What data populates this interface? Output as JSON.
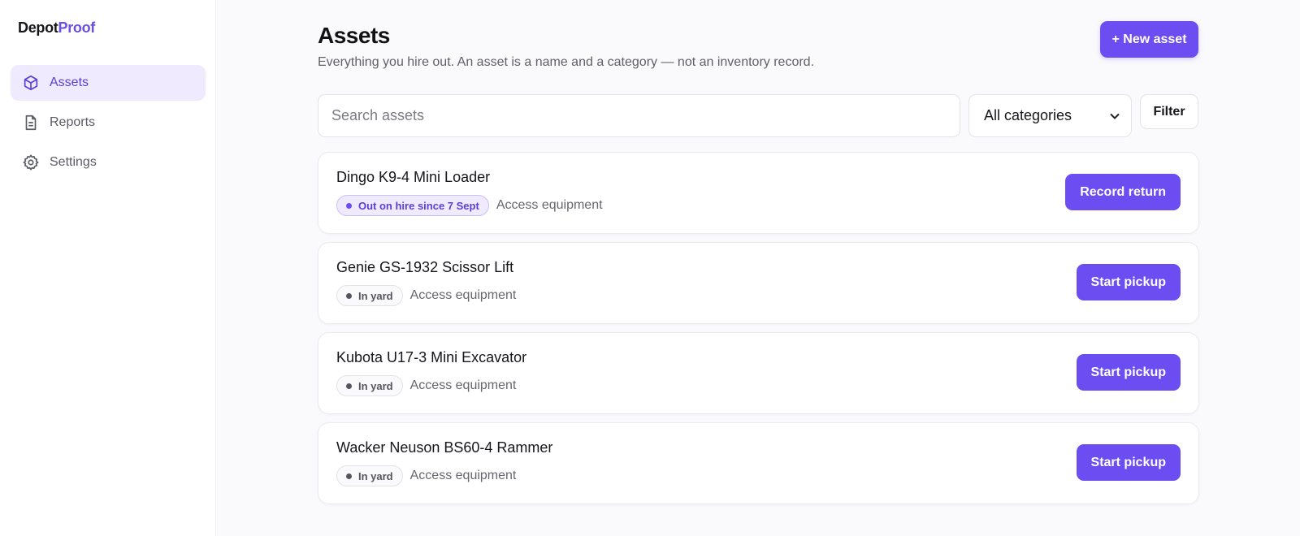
{
  "brand": {
    "part1": "Depot",
    "part2": "Proof"
  },
  "sidebar": {
    "items": [
      {
        "label": "Assets",
        "icon": "box-icon",
        "active": true
      },
      {
        "label": "Reports",
        "icon": "document-icon",
        "active": false
      },
      {
        "label": "Settings",
        "icon": "gear-icon",
        "active": false
      }
    ]
  },
  "header": {
    "title": "Assets",
    "subtitle": "Everything you hire out. An asset is a name and a category — not an inventory record.",
    "new_button": "+ New asset"
  },
  "toolbar": {
    "search_placeholder": "Search assets",
    "category_selected": "All categories",
    "filter_label": "Filter"
  },
  "assets": [
    {
      "name": "Dingo K9-4 Mini Loader",
      "status": "Out on hire since 7 Sept",
      "status_kind": "hire",
      "category": "Access equipment",
      "action": "Record return"
    },
    {
      "name": "Genie GS-1932 Scissor Lift",
      "status": "In yard",
      "status_kind": "yard",
      "category": "Access equipment",
      "action": "Start pickup"
    },
    {
      "name": "Kubota U17-3 Mini Excavator",
      "status": "In yard",
      "status_kind": "yard",
      "category": "Access equipment",
      "action": "Start pickup"
    },
    {
      "name": "Wacker Neuson BS60-4 Rammer",
      "status": "In yard",
      "status_kind": "yard",
      "category": "Access equipment",
      "action": "Start pickup"
    }
  ],
  "colors": {
    "accent": "#6c4df2",
    "accent_soft": "#efeafe",
    "accent_text": "#5a3fd6"
  }
}
